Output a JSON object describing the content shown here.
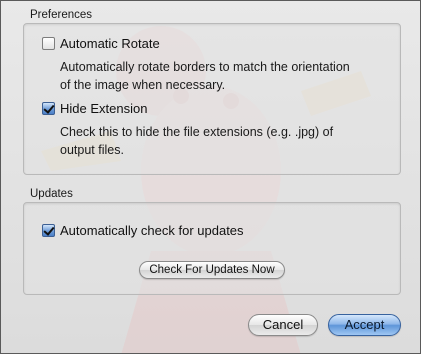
{
  "preferences": {
    "title": "Preferences",
    "auto_rotate": {
      "label": "Automatic Rotate",
      "checked": false,
      "description": "Automatically rotate borders to match the orientation of the image when necessary."
    },
    "hide_extension": {
      "label": "Hide Extension",
      "checked": true,
      "description": "Check this to hide the file extensions (e.g. .jpg) of output files."
    }
  },
  "updates": {
    "title": "Updates",
    "auto_check": {
      "label": "Automatically check for updates",
      "checked": true
    },
    "check_now_label": "Check For Updates Now"
  },
  "footer": {
    "cancel_label": "Cancel",
    "accept_label": "Accept"
  },
  "colors": {
    "accent": "#5e95d9",
    "window_bg": "#e2e2e2"
  }
}
